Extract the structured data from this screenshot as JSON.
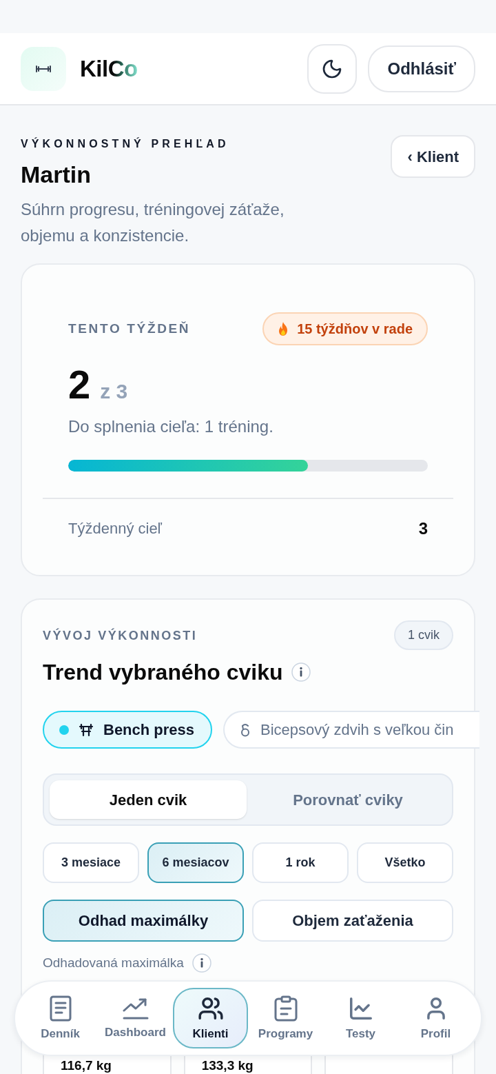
{
  "header": {
    "brand": "KilCo",
    "logout_button": "Odhlásiť"
  },
  "overview": {
    "eyebrow": "VÝKONNOSTNÝ PREHĽAD",
    "title": "Martin",
    "description": "Súhrn progresu, tréningovej záťaže, objemu a konzistencie.",
    "back_button": "‹ Klient"
  },
  "week_card": {
    "label": "TENTO TÝŽDEŇ",
    "streak": "15 týždňov v rade",
    "done": "2",
    "total": "z 3",
    "remaining": "Do splnenia cieľa: 1 tréning.",
    "progress": {
      "level": 0.667
    },
    "goal": {
      "label": "Týždenný cieľ",
      "value": "3"
    }
  },
  "trend_card": {
    "eyebrow": "VÝVOJ VÝKONNOSTI",
    "count_badge": "1 cvik",
    "title": "Trend vybraného cviku",
    "exercises": [
      {
        "label": "Bench press",
        "selected": true
      },
      {
        "label": "Bicepsový zdvih s veľkou čin",
        "selected": false
      }
    ],
    "modes": [
      {
        "label": "Jeden cvik",
        "selected": true
      },
      {
        "label": "Porovnať cviky",
        "selected": false
      }
    ],
    "periods": [
      {
        "label": "3 mesiace",
        "selected": false
      },
      {
        "label": "6 mesiacov",
        "selected": true
      },
      {
        "label": "1 rok",
        "selected": false
      },
      {
        "label": "Všetko",
        "selected": false
      }
    ],
    "metrics": [
      {
        "label": "Odhad maximálky",
        "selected": true
      },
      {
        "label": "Objem zaťaženia",
        "selected": false
      }
    ],
    "metric_label": "Odhadovaná maximálka",
    "stats": [
      {
        "value": "116,7 kg"
      },
      {
        "value": "133,3 kg"
      }
    ]
  },
  "bottom_nav": [
    {
      "label": "Denník",
      "selected": false
    },
    {
      "label": "Dashboard",
      "selected": false
    },
    {
      "label": "Klienti",
      "selected": true
    },
    {
      "label": "Programy",
      "selected": false
    },
    {
      "label": "Testy",
      "selected": false
    },
    {
      "label": "Profil",
      "selected": false
    }
  ]
}
